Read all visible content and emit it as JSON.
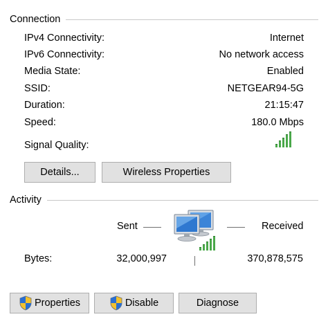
{
  "connection": {
    "title": "Connection",
    "rows": [
      {
        "label": "IPv4 Connectivity:",
        "value": "Internet"
      },
      {
        "label": "IPv6 Connectivity:",
        "value": "No network access"
      },
      {
        "label": "Media State:",
        "value": "Enabled"
      },
      {
        "label": "SSID:",
        "value": "NETGEAR94-5G"
      },
      {
        "label": "Duration:",
        "value": "21:15:47"
      },
      {
        "label": "Speed:",
        "value": "180.0 Mbps"
      }
    ],
    "signal_label": "Signal Quality:",
    "signal_bars_filled": 5,
    "signal_bars_total": 5
  },
  "buttons_top": {
    "details": "Details...",
    "wireless_properties": "Wireless Properties"
  },
  "activity": {
    "title": "Activity",
    "sent_label": "Sent",
    "received_label": "Received",
    "bytes_label": "Bytes:",
    "bytes_sent": "32,000,997",
    "bytes_received": "370,878,575"
  },
  "buttons_bottom": {
    "properties": "Properties",
    "disable": "Disable",
    "diagnose": "Diagnose"
  },
  "colors": {
    "signal_green": "#4aa84a",
    "button_face": "#e1e1e1",
    "button_border": "#adadad"
  }
}
